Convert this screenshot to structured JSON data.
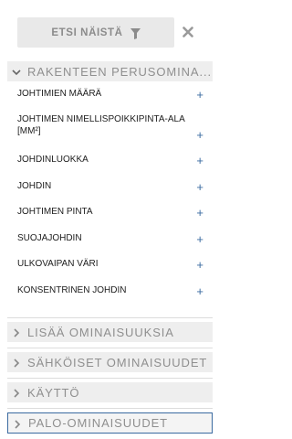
{
  "filter_button": {
    "label": "ETSI NÄISTÄ",
    "icon": "funnel-icon"
  },
  "close": {
    "icon": "close-icon"
  },
  "sections": [
    {
      "title": "RAKENTEEN PERUSOMINA...",
      "expanded": true,
      "icon": "chevron-down-icon"
    },
    {
      "title": "LISÄÄ OMINAISUUKSIA",
      "expanded": false,
      "icon": "chevron-right-icon"
    },
    {
      "title": "SÄHKÖISET OMINAISUUDET",
      "expanded": false,
      "icon": "chevron-right-icon"
    },
    {
      "title": "KÄYTTÖ",
      "expanded": false,
      "icon": "chevron-right-icon"
    },
    {
      "title": "PALO-OMINAISUUDET",
      "expanded": false,
      "icon": "chevron-right-icon",
      "focused": true
    }
  ],
  "properties": [
    {
      "label": "JOHTIMIEN MÄÄRÄ",
      "action": "+"
    },
    {
      "label": "JOHTIMEN NIMELLISPOIKKIPINTA-ALA [MM²]",
      "action": "+"
    },
    {
      "label": "JOHDINLUOKKA",
      "action": "+"
    },
    {
      "label": "JOHDIN",
      "action": "+"
    },
    {
      "label": "JOHTIMEN PINTA",
      "action": "+"
    },
    {
      "label": "SUOJAJOHDIN",
      "action": "+"
    },
    {
      "label": "ULKOVAIPAN VÄRI",
      "action": "+"
    },
    {
      "label": "KONSENTRINEN JOHDIN",
      "action": "+"
    }
  ],
  "colors": {
    "accent": "#3a6aa0",
    "header_bg": "#eeeeee",
    "button_bg": "#e9e9e9",
    "muted_text": "#8f8f8f"
  }
}
